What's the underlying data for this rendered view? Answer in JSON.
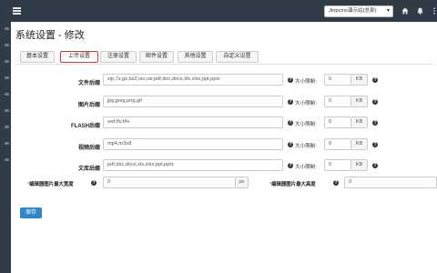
{
  "header": {
    "site_selector": "Jtopcms演示站(总部)",
    "menu_icon": "menu-icon",
    "home_icon": "home-icon",
    "bell_icon": "bell-icon",
    "more_icon": "more-vertical-icon"
  },
  "page": {
    "title": "系统设置 - 修改"
  },
  "tabs": [
    {
      "label": "基本设置"
    },
    {
      "label": "上传设置",
      "active": true
    },
    {
      "label": "注册设置"
    },
    {
      "label": "邮件设置"
    },
    {
      "label": "其他设置"
    },
    {
      "label": "自定义设置"
    }
  ],
  "form": {
    "size_label": "大小限制:",
    "unit": "KB",
    "rows": [
      {
        "label": "文件后缀",
        "value": "zip,7z,gz,bz2,iso,rar,pdf,doc,docx,xls,xlsx,ppt,pptx",
        "size": "0"
      },
      {
        "label": "图片后缀",
        "value": "jpg,jpeg,png,gif",
        "size": "0"
      },
      {
        "label": "FLASH后缀",
        "value": "swf,flv,f4v",
        "size": "0"
      },
      {
        "label": "视频后缀",
        "value": "mp4,m3u8",
        "size": "0"
      },
      {
        "label": "文库后缀",
        "value": "pdf,doc,docx,xls,xlsx,ppt,pptx",
        "size": "0"
      }
    ],
    "editor_image_width": {
      "label": "编辑器图片最大宽度",
      "value": "0",
      "unit": "px"
    },
    "editor_image_height": {
      "label": "编辑器图片最大高度",
      "value": "0"
    }
  },
  "actions": {
    "save_label": "保存"
  },
  "colors": {
    "nav_bg": "#2f3b47",
    "primary": "#2f86c8",
    "active_tab_border": "#d9342b"
  }
}
